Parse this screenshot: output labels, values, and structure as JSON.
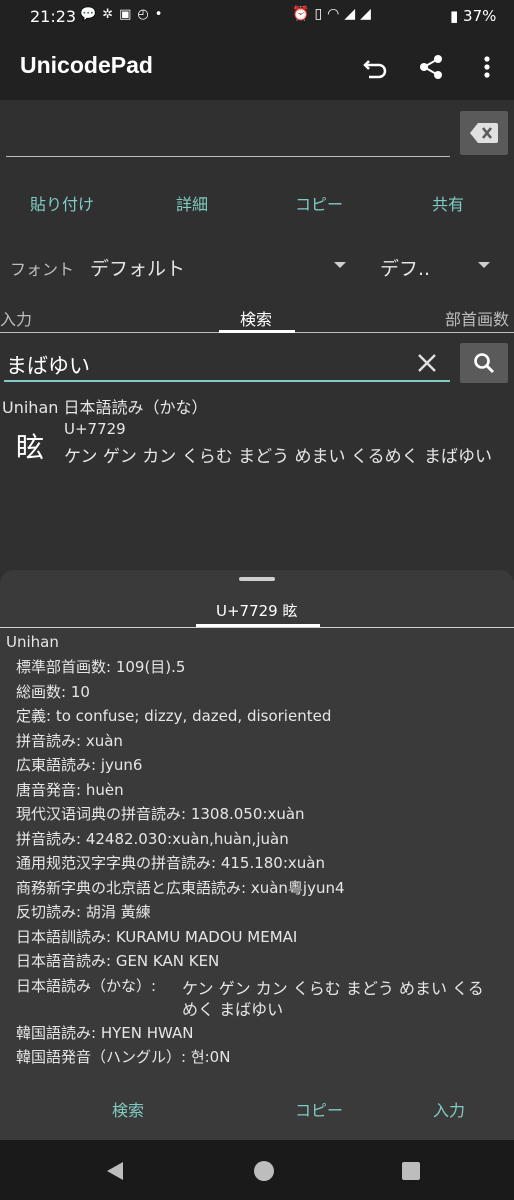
{
  "status": {
    "time": "21:23",
    "battery": "37%"
  },
  "appbar": {
    "title": "UnicodePad"
  },
  "actions": {
    "paste": "貼り付け",
    "detail": "詳細",
    "copy": "コピー",
    "share": "共有"
  },
  "font": {
    "label": "フォント",
    "value": "デフォルト",
    "value2": "デフ.."
  },
  "tabs": {
    "input": "入力",
    "search": "検索",
    "radical": "部首画数"
  },
  "search": {
    "query": "まばゆい"
  },
  "result": {
    "section": "Unihan 日本語読み（かな）",
    "glyph": "眩",
    "code": "U+7729",
    "reading": "ケン ゲン カン くらむ まどう めまい くるめく まばゆい"
  },
  "sheet": {
    "tab": "U+7729 眩",
    "section": "Unihan",
    "lines": [
      "標準部首画数: 109(目).5",
      "総画数: 10",
      "定義: to confuse; dizzy, dazed, disoriented",
      "拼音読み: xuàn",
      "広東語読み: jyun6",
      "唐音発音: huèn",
      "現代汉语词典の拼音読み: 1308.050:xuàn",
      "拼音読み: 42482.030:xuàn,huàn,juàn",
      "通用规范汉字字典の拼音読み: 415.180:xuàn",
      "商務新字典の北京語と広東語読み: xuàn粵jyun4",
      "反切読み: 胡涓 黃練",
      "日本語訓読み: KURAMU MADOU MEMAI",
      "日本語音読み: GEN KAN KEN"
    ],
    "kana_label": "日本語読み（かな）:",
    "kana_value1": "ケン ゲン カン くらむ まどう めまい くる",
    "kana_value2": "めく まばゆい",
    "korean1": "韓国語読み: HYEN HWAN",
    "korean2": "韓国語発音（ハングル）: 현:0N",
    "buttons": {
      "search": "検索",
      "copy": "コピー",
      "input": "入力"
    }
  }
}
